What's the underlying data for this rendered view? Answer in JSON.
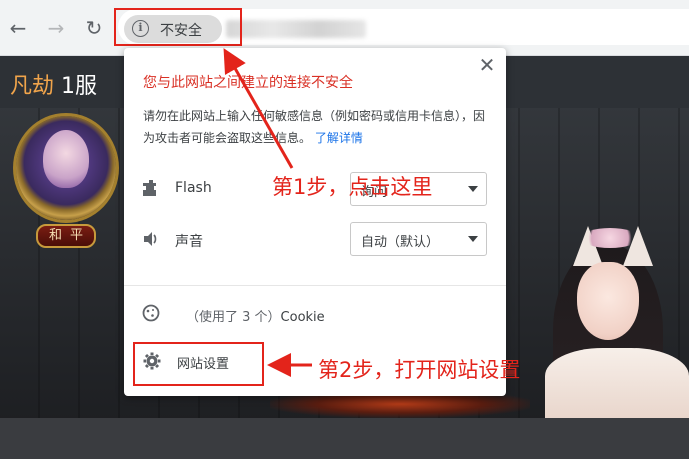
{
  "browser": {
    "back_icon": "arrow-left",
    "forward_icon": "arrow-right",
    "reload_icon": "reload",
    "security_label": "不安全",
    "info_icon_glyph": "i"
  },
  "page": {
    "game_title_accent": "凡劫",
    "game_title_rest": " 1服",
    "avatar_badge": "和平"
  },
  "popup": {
    "title": "您与此网站之间建立的连接不安全",
    "description": "请勿在此网站上输入任何敏感信息（例如密码或信用卡信息），因为攻击者可能会盗取这些信息。",
    "details_link": "了解详情",
    "permissions": [
      {
        "icon": "puzzle-icon",
        "label": "Flash",
        "value": "询问"
      },
      {
        "icon": "speaker-icon",
        "label": "声音",
        "value": "自动（默认）"
      }
    ],
    "cookie_prefix": "（使用了 3 个）",
    "cookie_label": "Cookie",
    "site_settings": "网站设置"
  },
  "annotations": {
    "step1": "第1步，点击这里",
    "step2": "第2步，打开网站设置"
  },
  "colors": {
    "annotation_red": "#e3241b",
    "warning_red": "#d93025",
    "link_blue": "#1a73e8",
    "title_accent": "#f0a44b"
  }
}
